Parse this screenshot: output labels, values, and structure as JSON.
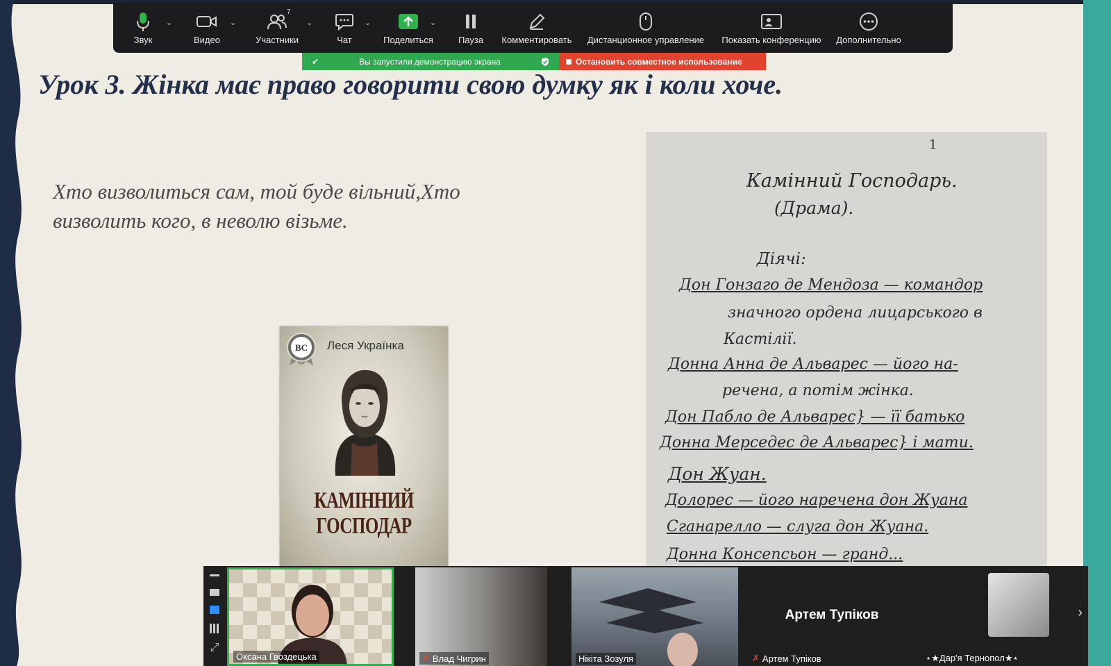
{
  "toolbar": {
    "items": [
      {
        "label": "Звук",
        "icon": "microphone-icon"
      },
      {
        "label": "Видео",
        "icon": "video-camera-icon"
      },
      {
        "label": "Участники",
        "icon": "participants-icon",
        "count": "7"
      },
      {
        "label": "Чат",
        "icon": "chat-icon"
      },
      {
        "label": "Поделиться",
        "icon": "share-screen-icon"
      },
      {
        "label": "Пауза",
        "icon": "pause-icon"
      },
      {
        "label": "Комментировать",
        "icon": "pencil-icon"
      },
      {
        "label": "Дистанционное управление",
        "icon": "mouse-icon"
      },
      {
        "label": "Показать конференцию",
        "icon": "show-meeting-icon"
      },
      {
        "label": "Дополнительно",
        "icon": "more-icon"
      }
    ]
  },
  "share_bar": {
    "status": "Вы запустили демонстрацию экрана",
    "stop": "Остановить совместное использование"
  },
  "slide": {
    "title_main": "Урок 3. Жінка має право говорити свою думку як і коли хоче",
    "title_end": ".",
    "quote_line1": "Хто визволиться сам, той буде вільний,Хто",
    "quote_line2": "визволить кого, в неволю візьме.",
    "book": {
      "logo": "ВС",
      "author": "Леся Українка",
      "title": "КАМІННИЙ ГОСПОДАР"
    },
    "manuscript": {
      "page_number": "1",
      "lines": [
        "Камінний Господарь.",
        "(Драма).",
        "Діячі:",
        "Дон Гонзаго де Мендоза — командор",
        "значного ордена лицарського в",
        "Кастілії.",
        "Донна Анна де Альварес — його на-",
        "речена, а потім жінка.",
        "Дон Пабло де Альварес} — її батько",
        "Донна Мерседес де Альварес}    і мати.",
        "Дон Жуан.",
        "Долорес — його наречена дон Жуана",
        "Сганарелло — слуга дон Жуана.",
        "Донна Консепсьон — гранд..."
      ]
    }
  },
  "gallery": {
    "participants": [
      {
        "name": "Оксана Гвоздецька",
        "muted": false,
        "active": true
      },
      {
        "name": "Влад Чигрин",
        "muted": true
      },
      {
        "name": "Нікіта Зозуля",
        "muted": false
      },
      {
        "name": "Артем Тупіков",
        "muted": true,
        "display": "Артем Тупіков"
      },
      {
        "name": "⋆★Дар'я Тернопол★⋆",
        "muted": false
      }
    ],
    "next": "›"
  }
}
